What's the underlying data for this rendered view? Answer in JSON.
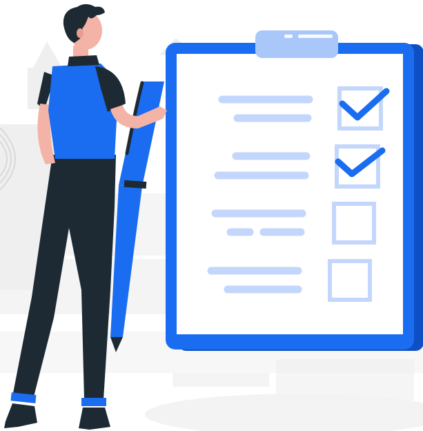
{
  "illustration": {
    "subject": "person-with-checklist",
    "checklist": {
      "items": [
        {
          "checked": true
        },
        {
          "checked": true
        },
        {
          "checked": false
        },
        {
          "checked": false
        }
      ]
    },
    "colors": {
      "accent": "#1a6df0",
      "accent_dark": "#0f4fc4",
      "accent_light": "#c3d6fb",
      "clip": "#aac7fa",
      "paper": "#ffffff",
      "dark": "#1e2a33",
      "skin": "#f4b3a7",
      "background_shapes": "#efefef"
    },
    "icons": [
      "clipboard-icon",
      "pen-icon",
      "checkmark-icon"
    ]
  }
}
